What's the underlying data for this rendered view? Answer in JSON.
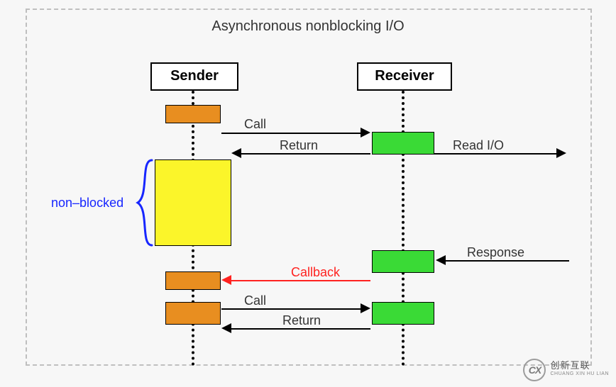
{
  "title": "Asynchronous nonblocking I/O",
  "participants": {
    "sender": "Sender",
    "receiver": "Receiver"
  },
  "annotations": {
    "nonblocked": "non–blocked"
  },
  "messages": {
    "call1": "Call",
    "return1": "Return",
    "readio": "Read I/O",
    "response": "Response",
    "callback": "Callback",
    "call2": "Call",
    "return2": "Return"
  },
  "logo": {
    "mark": "CX",
    "line1": "创新互联",
    "line2": "CHUANG XIN HU LIAN"
  },
  "chart_data": {
    "type": "sequence-diagram",
    "title": "Asynchronous nonblocking I/O",
    "participants": [
      "Sender",
      "Receiver"
    ],
    "steps": [
      {
        "from": "Sender",
        "to": "Receiver",
        "label": "Call",
        "direction": "right",
        "color": "black"
      },
      {
        "from": "Receiver",
        "to": "Sender",
        "label": "Return",
        "direction": "left",
        "color": "black"
      },
      {
        "from": "Receiver",
        "to": "external",
        "label": "Read I/O",
        "direction": "right",
        "color": "black"
      },
      {
        "note_on": "Sender",
        "label": "non–blocked",
        "style": "brace",
        "color": "blue"
      },
      {
        "from": "external",
        "to": "Receiver",
        "label": "Response",
        "direction": "left",
        "color": "black"
      },
      {
        "from": "Receiver",
        "to": "Sender",
        "label": "Callback",
        "direction": "left",
        "color": "red"
      },
      {
        "from": "Sender",
        "to": "Receiver",
        "label": "Call",
        "direction": "right",
        "color": "black"
      },
      {
        "from": "Receiver",
        "to": "Sender",
        "label": "Return",
        "direction": "left",
        "color": "black"
      }
    ],
    "activation_colors": {
      "Sender": [
        "orange",
        "yellow",
        "orange",
        "orange"
      ],
      "Receiver": [
        "green",
        "green",
        "green"
      ]
    }
  }
}
